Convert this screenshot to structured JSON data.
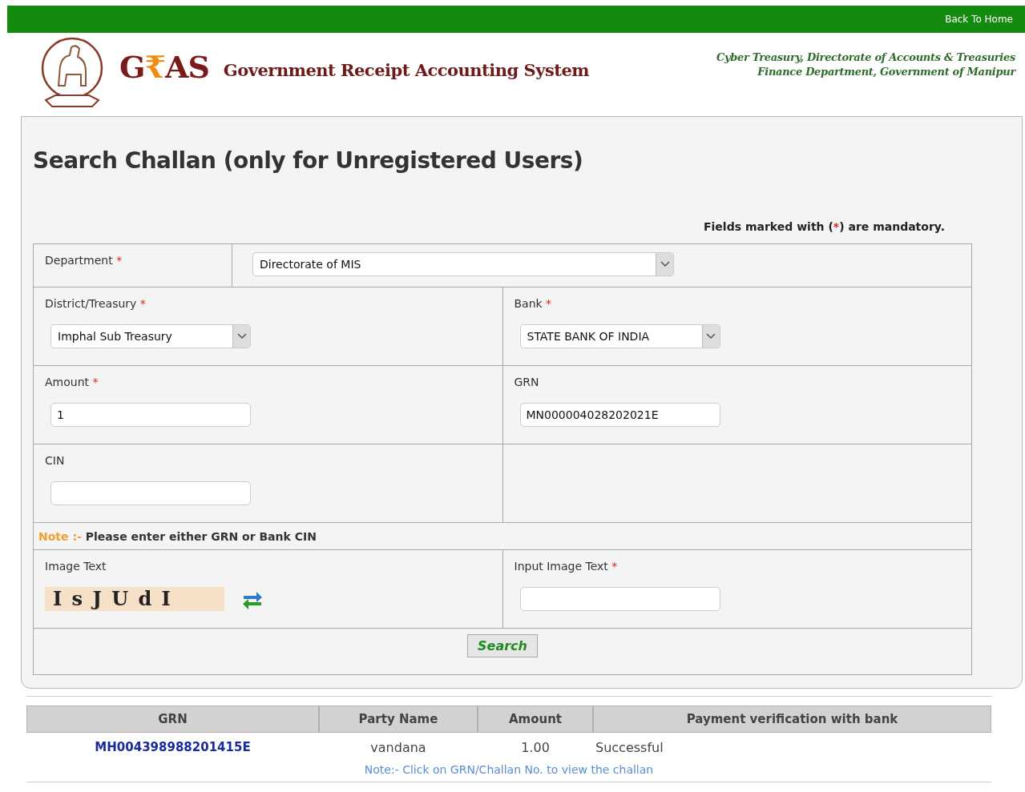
{
  "top_bar": {
    "back_link": "Back To Home"
  },
  "header": {
    "logo": [
      {
        "text": "G",
        "accent": false
      },
      {
        "text": "₹",
        "accent": true
      },
      {
        "text": "AS",
        "accent": false
      }
    ],
    "title": "Government Receipt Accounting System",
    "org_lines": [
      "Cyber Treasury, Directorate of Accounts & Treasuries",
      "Finance Department, Government of Manipur"
    ]
  },
  "page_title": "Search Challan (only for Unregistered Users)",
  "required_mark": "*",
  "mandatory_note": {
    "before": "Fields marked with (",
    "after": ") are mandatory."
  },
  "form": {
    "department": {
      "label": "Department",
      "required": true,
      "kind": "select",
      "value": "Directorate of MIS"
    },
    "rows": [
      [
        {
          "label": "District/Treasury",
          "required": true,
          "kind": "select",
          "value": "Imphal Sub Treasury"
        },
        {
          "label": "Bank",
          "required": true,
          "kind": "select",
          "value": "STATE BANK OF INDIA"
        }
      ],
      [
        {
          "label": "Amount",
          "required": true,
          "kind": "text",
          "value": "1"
        },
        {
          "label": "GRN",
          "required": false,
          "kind": "text",
          "value": "MN000004028202021E"
        }
      ],
      [
        {
          "label": "CIN",
          "required": false,
          "kind": "text"
        }
      ]
    ],
    "note": {
      "label": "Note :-",
      "text": "Please enter either GRN or Bank CIN"
    },
    "captcha": {
      "label": "Image Text",
      "code": "I s J U d I"
    },
    "captcha_input": {
      "label": "Input Image Text",
      "required": true,
      "kind": "text"
    },
    "search_button": "Search"
  },
  "results": {
    "columns": [
      "GRN",
      "Party Name",
      "Amount",
      "Payment verification with bank"
    ],
    "rows": [
      {
        "grn": "MH004398988201415E",
        "party_name": "vandana",
        "amount": "1.00",
        "verification": "Successful"
      }
    ],
    "note": "Note:- Click on GRN/Challan No. to view the challan"
  }
}
